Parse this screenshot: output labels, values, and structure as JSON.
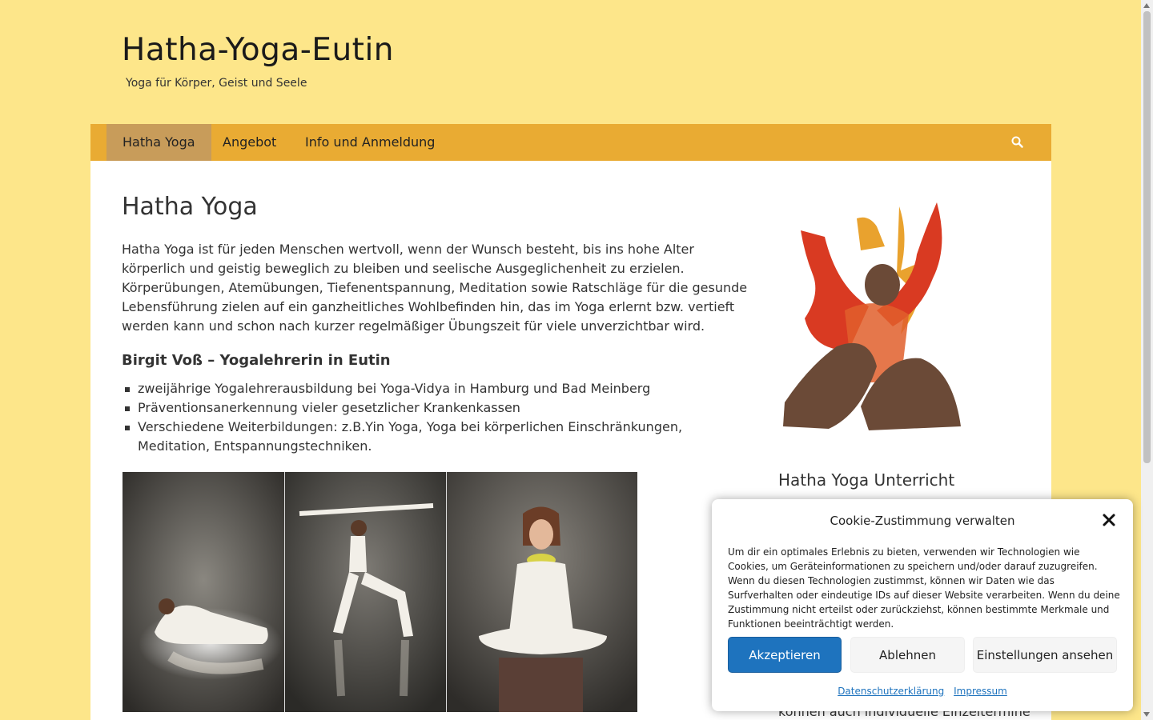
{
  "site": {
    "title": "Hatha-Yoga-Eutin",
    "tagline": "Yoga für Körper, Geist und Seele"
  },
  "nav": {
    "items": [
      {
        "label": "Hatha Yoga",
        "active": true
      },
      {
        "label": "Angebot",
        "active": false
      },
      {
        "label": "Info und Anmeldung",
        "active": false
      }
    ],
    "search_icon": "search-icon"
  },
  "main": {
    "title": "Hatha Yoga",
    "intro_p1": "Hatha Yoga ist für jeden Menschen wertvoll, wenn der Wunsch besteht, bis ins hohe Alter körperlich und geistig beweglich zu bleiben und seelische Ausgeglichenheit zu erzielen.",
    "intro_p2": "Körperübungen, Atemübungen, Tiefenentspannung, Meditation sowie Ratschläge für die gesunde Le­bensführung zielen auf ein ganzheitliches Wohlbefinden hin, das im Yoga erlernt bzw. vertieft werden kann und schon nach kurzer regelmäßiger Übungszeit für viele unverzichtbar wird.",
    "subheading": "Birgit Voß – Yogalehrerin in Eutin",
    "bullets": [
      "zweijährige Yogalehrerausbildung bei Yoga-Vidya in Hamburg und Bad Meinberg",
      "Präventionsanerkennung vieler gesetzlicher Krankenkassen",
      "Verschiedene Weiterbildungen: z.B.Yin Yoga, Yoga bei körperlichen Einschränkungen, Meditation, Entspannungstechniken."
    ]
  },
  "sidebar": {
    "heading": "Hatha Yoga Unterricht",
    "partial_text": "können auch individuelle Einzeltermine"
  },
  "cookie": {
    "title": "Cookie-Zustimmung verwalten",
    "text": "Um dir ein optimales Erlebnis zu bieten, verwenden wir Technologien wie Cookies, um Geräteinformationen zu speichern und/oder darauf zuzugreifen. Wenn du diesen Technologien zustimmst, können wir Daten wie das Surfverhalten oder eindeutige IDs auf dieser Website verarbeiten. Wenn du deine Zustimmung nicht erteilst oder zurückziehst, können bestimmte Merkmale und Funktionen beeinträchtigt werden.",
    "accept": "Akzeptieren",
    "deny": "Ablehnen",
    "preferences": "Einstellungen ansehen",
    "privacy_link": "Datenschutzerklärung",
    "imprint_link": "Impressum"
  },
  "colors": {
    "page_bg": "#fde68a",
    "nav_bg": "#e9ab33",
    "nav_active": "#c89c5a",
    "accent_button": "#1e73be"
  }
}
